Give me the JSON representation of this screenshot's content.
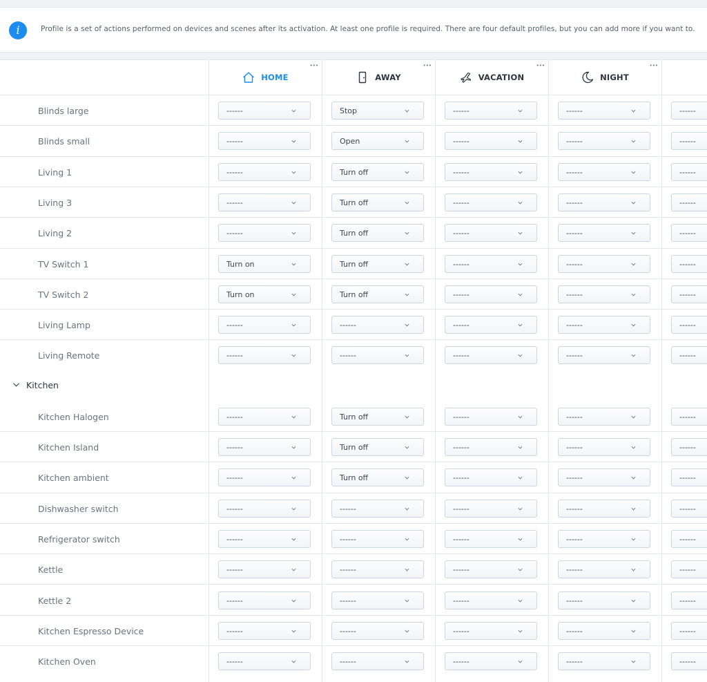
{
  "info": {
    "icon": "info-icon",
    "text": "Profile is a set of actions performed on devices and scenes after its activation. At least one profile is required. There are four default profiles, but you can add more if you want to."
  },
  "accent_color": "#1c8cf0",
  "columns": [
    {
      "label": "HOME",
      "icon": "home-icon",
      "active": true
    },
    {
      "label": "AWAY",
      "icon": "door-icon",
      "active": false
    },
    {
      "label": "VACATION",
      "icon": "airplane-icon",
      "active": false
    },
    {
      "label": "NIGHT",
      "icon": "moon-icon",
      "active": false
    },
    {
      "label": "",
      "icon": "weather-icon",
      "active": false
    }
  ],
  "rows": [
    {
      "label": "Blinds large",
      "values": [
        "------",
        "Stop",
        "------",
        "------",
        "------"
      ]
    },
    {
      "label": "Blinds small",
      "values": [
        "------",
        "Open",
        "------",
        "------",
        "------"
      ]
    },
    {
      "label": "Living 1",
      "values": [
        "------",
        "Turn off",
        "------",
        "------",
        "------"
      ]
    },
    {
      "label": "Living 3",
      "values": [
        "------",
        "Turn off",
        "------",
        "------",
        "------"
      ]
    },
    {
      "label": "Living 2",
      "values": [
        "------",
        "Turn off",
        "------",
        "------",
        "------"
      ]
    },
    {
      "label": "TV Switch 1",
      "values": [
        "Turn on",
        "Turn off",
        "------",
        "------",
        "------"
      ]
    },
    {
      "label": "TV Switch 2",
      "values": [
        "Turn on",
        "Turn off",
        "------",
        "------",
        "------"
      ]
    },
    {
      "label": "Living Lamp",
      "values": [
        "------",
        "------",
        "------",
        "------",
        "------"
      ]
    },
    {
      "label": "Living Remote",
      "values": [
        "------",
        "------",
        "------",
        "------",
        "------"
      ]
    },
    {
      "section": "Kitchen"
    },
    {
      "label": "Kitchen Halogen",
      "values": [
        "------",
        "Turn off",
        "------",
        "------",
        "------"
      ]
    },
    {
      "label": "Kitchen Island",
      "values": [
        "------",
        "Turn off",
        "------",
        "------",
        "------"
      ]
    },
    {
      "label": "Kitchen ambient",
      "values": [
        "------",
        "Turn off",
        "------",
        "------",
        "------"
      ]
    },
    {
      "label": "Dishwasher switch",
      "values": [
        "------",
        "------",
        "------",
        "------",
        "------"
      ]
    },
    {
      "label": "Refrigerator switch",
      "values": [
        "------",
        "------",
        "------",
        "------",
        "------"
      ]
    },
    {
      "label": "Kettle",
      "values": [
        "------",
        "------",
        "------",
        "------",
        "------"
      ]
    },
    {
      "label": "Kettle 2",
      "values": [
        "------",
        "------",
        "------",
        "------",
        "------"
      ]
    },
    {
      "label": "Kitchen Espresso Device",
      "values": [
        "------",
        "------",
        "------",
        "------",
        "------"
      ]
    },
    {
      "label": "Kitchen Oven",
      "values": [
        "------",
        "------",
        "------",
        "------",
        "------"
      ]
    }
  ]
}
